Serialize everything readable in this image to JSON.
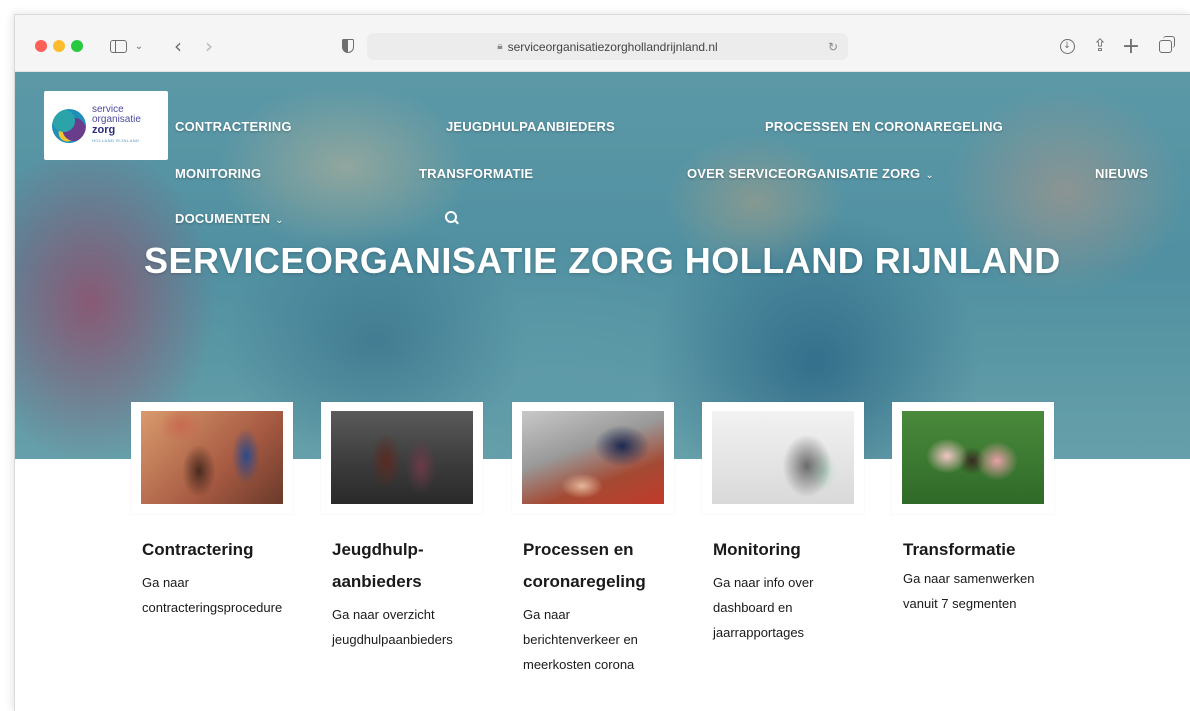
{
  "browser": {
    "url": "serviceorganisatiezorghollandrijnland.nl",
    "icons": [
      "sidebar-icon",
      "chevron-down-icon",
      "back-icon",
      "forward-icon",
      "shield-icon",
      "lock-icon",
      "reload-icon",
      "download-icon",
      "share-icon",
      "new-tab-icon",
      "tabs-overview-icon"
    ]
  },
  "logo": {
    "line1": "service",
    "line2": "organisatie",
    "line3": "zorg",
    "line4": "HOLLAND RIJNLAND"
  },
  "nav": {
    "contractering": "CONTRACTERING",
    "jeugdhulpaanbieders": "JEUGDHULPAANBIEDERS",
    "processen": "PROCESSEN EN CORONAREGELING",
    "monitoring": "MONITORING",
    "transformatie": "TRANSFORMATIE",
    "over": "OVER SERVICEORGANISATIE ZORG",
    "nieuws": "NIEUWS",
    "documenten": "DOCUMENTEN",
    "chevron": "⌄"
  },
  "hero": {
    "title": "SERVICEORGANISATIE ZORG HOLLAND RIJNLAND"
  },
  "cards": [
    {
      "title": "Contractering",
      "desc": "Ga naar contracteringsprocedure"
    },
    {
      "title": "Jeugdhulp-aanbieders",
      "desc": "Ga naar overzicht jeugdhulpaanbieders"
    },
    {
      "title": "Processen en coronaregeling",
      "desc": "Ga naar berichtenverkeer en meerkosten corona"
    },
    {
      "title": "Monitoring",
      "desc": "Ga naar info over dashboard en jaarrapportages"
    },
    {
      "title": "Transformatie",
      "desc": "Ga naar samenwerken vanuit 7 segmenten"
    }
  ],
  "colors": {
    "overlay": "#1e8296",
    "traffic_red": "#fe5f57",
    "traffic_yellow": "#febc2e",
    "traffic_green": "#28c840"
  }
}
